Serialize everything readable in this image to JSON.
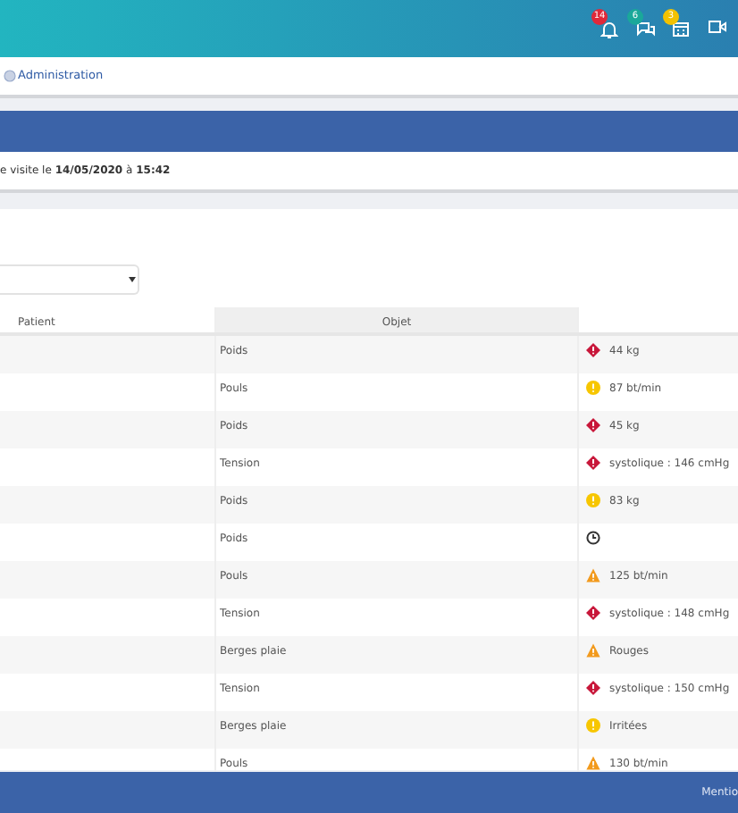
{
  "header": {
    "notifications": [
      {
        "kind": "bell",
        "count": "14",
        "color": "#e0293a"
      },
      {
        "kind": "chat",
        "count": "6",
        "color": "#1aa89a"
      },
      {
        "kind": "calendar",
        "count": "3",
        "color": "#f2c200"
      },
      {
        "kind": "video"
      }
    ]
  },
  "breadcrumb": {
    "label": "Administration"
  },
  "visit_info": "e visite le **14/05/2020** à **15:42**",
  "table": {
    "columns": [
      "Patient",
      "Objet"
    ],
    "rows": [
      {
        "objet": "Poids",
        "kind": "critical",
        "reading": "44 kg"
      },
      {
        "objet": "Pouls",
        "kind": "warning",
        "reading": "87 bt/min"
      },
      {
        "objet": "Poids",
        "kind": "critical",
        "reading": "45 kg"
      },
      {
        "objet": "Tension",
        "kind": "critical",
        "reading": "systolique : 146 cmHg"
      },
      {
        "objet": "Poids",
        "kind": "warning",
        "reading": "83 kg"
      },
      {
        "objet": "Poids",
        "kind": "pending"
      },
      {
        "objet": "Pouls",
        "kind": "alert",
        "reading": "125 bt/min"
      },
      {
        "objet": "Tension",
        "kind": "critical",
        "reading": "systolique : 148 cmHg"
      },
      {
        "objet": "Berges plaie",
        "kind": "alert",
        "reading": "Rouges"
      },
      {
        "objet": "Tension",
        "kind": "critical",
        "reading": "systolique : 150 cmHg"
      },
      {
        "objet": "Berges plaie",
        "kind": "warning",
        "reading": "Irritées"
      },
      {
        "objet": "Pouls",
        "kind": "alert",
        "reading": "130 bt/min"
      }
    ]
  },
  "footer": {
    "link": "Mentio"
  }
}
